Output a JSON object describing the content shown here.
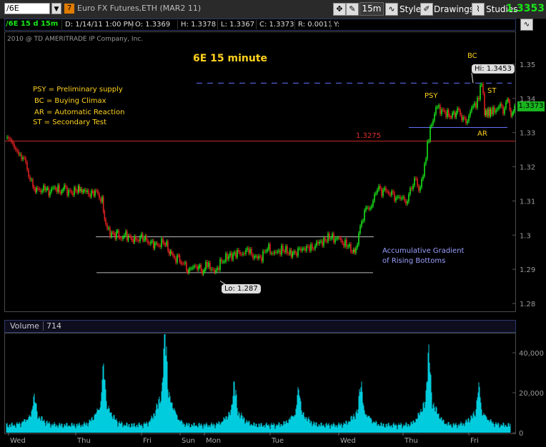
{
  "toolbar": {
    "symbol": "/6E",
    "symbol_dropdown": "▼",
    "link_badge": "7",
    "description": "Euro FX Futures,ETH (MAR2 11)",
    "aggregation": "15m",
    "style_label": "Style",
    "drawings_label": "Drawings",
    "studies_label": "Studies",
    "last_price": "1.3353"
  },
  "infobar": {
    "symbol": "/6E 15 d 15m",
    "date": "D: 1/14/11 1:00 PM",
    "open": "O: 1.3369",
    "high": "H: 1.3378",
    "low": "L: 1.3367",
    "close": "C: 1.3373",
    "range": "R: 0.0011",
    "y": "Y:"
  },
  "main": {
    "copyright": "2010 @ TD AMERITRADE IP Company, Inc.",
    "title": "6E 15 minute",
    "legend": [
      "PSY = Preliminary supply",
      "BC = Buying Climax",
      "AR = Automatic Reaction",
      "ST = Secondary Test"
    ],
    "annotations": {
      "level": "1.3275",
      "psy": "PSY",
      "bc": "BC",
      "ar": "AR",
      "st": "ST",
      "hi": "Hi: 1.3453",
      "lo": "Lo: 1.287",
      "gradient_line1": "Accumulative Gradient",
      "gradient_line2": "of Rising Bottoms"
    },
    "price_tag": "1.3373"
  },
  "volume": {
    "label": "Volume",
    "value": "714"
  },
  "colors": {
    "up": "#19e619",
    "down": "#e02020",
    "volume": "#00ccdd",
    "resistance": "#cc2a2a",
    "dashed": "#6670ff",
    "annotation": "#ffd21f"
  },
  "chart_data": [
    {
      "type": "line",
      "title": "6E 15 minute",
      "ylim": [
        1.28,
        1.355
      ],
      "y_ticks": [
        "1.35",
        "1.34",
        "1.33",
        "1.32",
        "1.31",
        "1.3",
        "1.29",
        "1.28"
      ],
      "x_ticks": [
        "Wed",
        "Thu",
        "Fri",
        "Sun",
        "Mon",
        "Tue",
        "Wed",
        "Thu",
        "Fri"
      ],
      "series": [
        {
          "name": "/6E 15m close (approx.)",
          "x": [
            0,
            4,
            8,
            12,
            16,
            20,
            26,
            32,
            38,
            45,
            55,
            62,
            68,
            75,
            82,
            90,
            100,
            105,
            110,
            118,
            125,
            135,
            140,
            148,
            155,
            160,
            168,
            175,
            182,
            190,
            197,
            205,
            212,
            220,
            227,
            234,
            240,
            247,
            253,
            258,
            262,
            270,
            275,
            280,
            288,
            292,
            300,
            310,
            320,
            330,
            340,
            350,
            358,
            366,
            376,
            386,
            396,
            405,
            415,
            425,
            435,
            445,
            455,
            465,
            475,
            485,
            490,
            496,
            502,
            508,
            512,
            516,
            522,
            528,
            534,
            540,
            546,
            552,
            556,
            560,
            568,
            574,
            578,
            582,
            586,
            590,
            596,
            602,
            610,
            618,
            625,
            632,
            640,
            646,
            650,
            654,
            658,
            662,
            666,
            670,
            675,
            680,
            686,
            692,
            698,
            702,
            707,
            712
          ],
          "values": [
            1.3285,
            1.328,
            1.3275,
            1.326,
            1.325,
            1.324,
            1.322,
            1.318,
            1.314,
            1.313,
            1.3135,
            1.3125,
            1.314,
            1.313,
            1.3135,
            1.3125,
            1.313,
            1.314,
            1.3125,
            1.312,
            1.3128,
            1.31,
            1.302,
            1.3005,
            1.3,
            1.2995,
            1.3,
            1.299,
            1.2985,
            1.2995,
            1.2985,
            1.2975,
            1.297,
            1.298,
            1.2965,
            1.2935,
            1.293,
            1.292,
            1.2905,
            1.2895,
            1.29,
            1.291,
            1.2895,
            1.291,
            1.2905,
            1.2885,
            1.292,
            1.2935,
            1.2945,
            1.295,
            1.2955,
            1.293,
            1.2935,
            1.2965,
            1.294,
            1.296,
            1.295,
            1.2945,
            1.2965,
            1.296,
            1.297,
            1.2985,
            1.2995,
            1.2985,
            1.2975,
            1.2955,
            1.296,
            1.302,
            1.307,
            1.308,
            1.309,
            1.312,
            1.3135,
            1.3125,
            1.313,
            1.3115,
            1.311,
            1.3105,
            1.312,
            1.3095,
            1.314,
            1.3165,
            1.3135,
            1.3165,
            1.3205,
            1.3265,
            1.3325,
            1.3375,
            1.3365,
            1.3355,
            1.3345,
            1.3365,
            1.334,
            1.3335,
            1.3355,
            1.3375,
            1.3375,
            1.3405,
            1.3453,
            1.3365,
            1.336,
            1.3355,
            1.337,
            1.3375,
            1.3365,
            1.3395,
            1.3355,
            1.3375
          ]
        }
      ]
    },
    {
      "type": "bar",
      "title": "Volume",
      "ylim": [
        0,
        50000
      ],
      "y_ticks": [
        "40,000",
        "20,000",
        "0"
      ],
      "x_ticks": [
        "Wed",
        "Thu",
        "Fri",
        "Sun",
        "Mon",
        "Tue",
        "Wed",
        "Thu",
        "Fri"
      ],
      "series": [
        {
          "name": "Volume",
          "x": [
            40,
            137,
            223,
            320,
            410,
            497,
            592,
            662
          ],
          "values": [
            16000,
            32000,
            53000,
            23000,
            20000,
            23000,
            40000,
            21000
          ]
        }
      ]
    }
  ]
}
